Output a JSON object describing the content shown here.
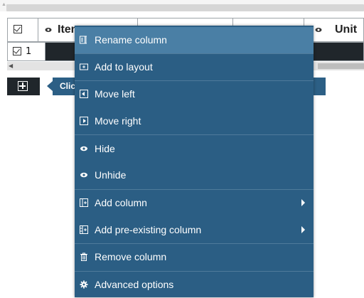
{
  "grid": {
    "columns": [
      {
        "label": "Item"
      },
      {
        "label": "Unit"
      }
    ],
    "row": {
      "number": "1"
    },
    "hint": "Click"
  },
  "context_menu": {
    "items": [
      {
        "label": "Rename column",
        "icon": "rename-column-icon"
      },
      {
        "label": "Add to layout",
        "icon": "add-to-layout-icon"
      },
      {
        "label": "Move left",
        "icon": "move-left-icon"
      },
      {
        "label": "Move right",
        "icon": "move-right-icon"
      },
      {
        "label": "Hide",
        "icon": "eye-icon"
      },
      {
        "label": "Unhide",
        "icon": "eye-icon"
      },
      {
        "label": "Add column",
        "icon": "add-column-icon",
        "submenu": true
      },
      {
        "label": "Add pre-existing column",
        "icon": "add-pre-existing-column-icon",
        "submenu": true
      },
      {
        "label": "Remove column",
        "icon": "trash-icon"
      },
      {
        "label": "Advanced options",
        "icon": "gear-icon"
      }
    ]
  },
  "colors": {
    "menu_bg": "#2b5e84",
    "menu_highlight": "#4a7fa5",
    "grid_dark": "#20262b"
  }
}
